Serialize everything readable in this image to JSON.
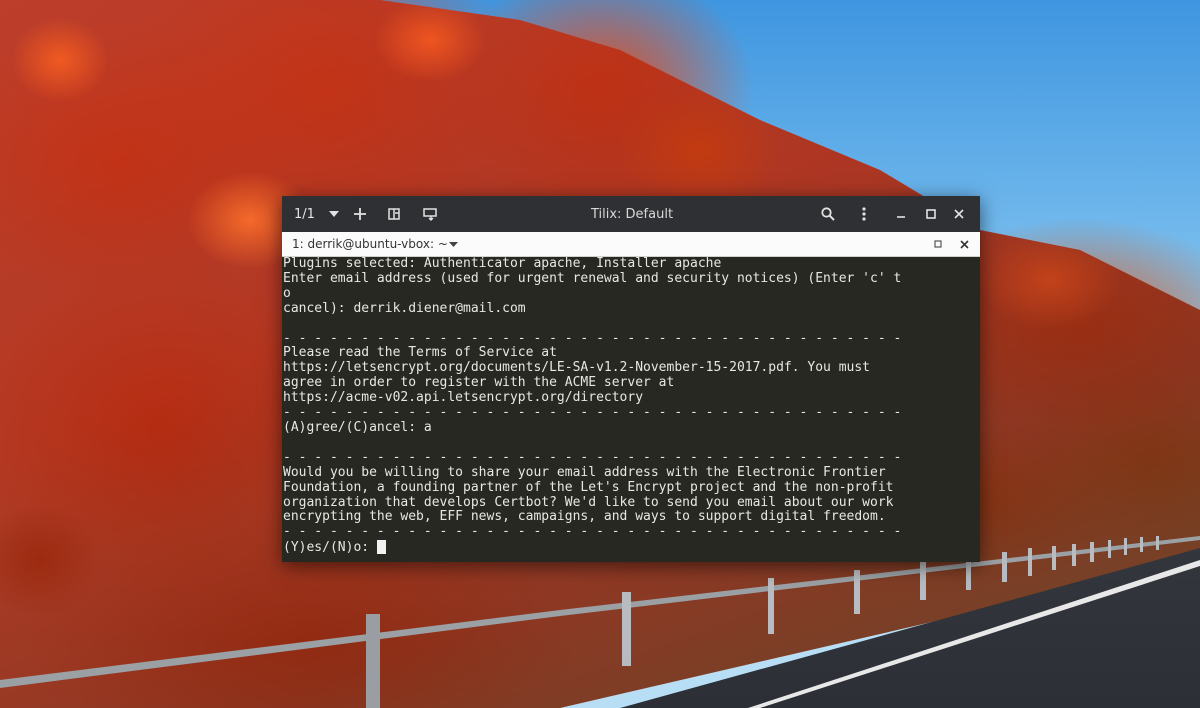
{
  "window": {
    "session_count": "1/1",
    "title": "Tilix: Default"
  },
  "tab": {
    "title": "1: derrik@ubuntu-vbox: ~"
  },
  "terminal": {
    "lines": [
      "Plugins selected: Authenticator apache, Installer apache",
      "Enter email address (used for urgent renewal and security notices) (Enter 'c' t",
      "o",
      "cancel): derrik.diener@mail.com",
      "",
      "- - - - - - - - - - - - - - - - - - - - - - - - - - - - - - - - - - - - - - - -",
      "Please read the Terms of Service at",
      "https://letsencrypt.org/documents/LE-SA-v1.2-November-15-2017.pdf. You must",
      "agree in order to register with the ACME server at",
      "https://acme-v02.api.letsencrypt.org/directory",
      "- - - - - - - - - - - - - - - - - - - - - - - - - - - - - - - - - - - - - - - -",
      "(A)gree/(C)ancel: a",
      "",
      "- - - - - - - - - - - - - - - - - - - - - - - - - - - - - - - - - - - - - - - -",
      "Would you be willing to share your email address with the Electronic Frontier",
      "Foundation, a founding partner of the Let's Encrypt project and the non-profit",
      "organization that develops Certbot? We'd like to send you email about our work",
      "encrypting the web, EFF news, campaigns, and ways to support digital freedom.",
      "- - - - - - - - - - - - - - - - - - - - - - - - - - - - - - - - - - - - - - - -"
    ],
    "prompt": "(Y)es/(N)o: "
  },
  "icons": {
    "session_menu": "chevron-down-icon",
    "add_terminal": "plus-icon",
    "split_right": "split-horizontal-icon",
    "split_down": "split-vertical-icon",
    "find": "search-icon",
    "menu": "kebab-menu-icon",
    "minimize": "minimize-icon",
    "maximize": "maximize-icon",
    "close": "close-icon",
    "tab_menu": "caret-down-icon",
    "tab_maximize": "maximize-icon",
    "tab_close": "close-icon"
  },
  "colors": {
    "titlebar_bg": "#2f3033",
    "terminal_bg": "#272822",
    "terminal_fg": "#e8e8e2",
    "tabbar_bg": "#fbfbfb"
  }
}
